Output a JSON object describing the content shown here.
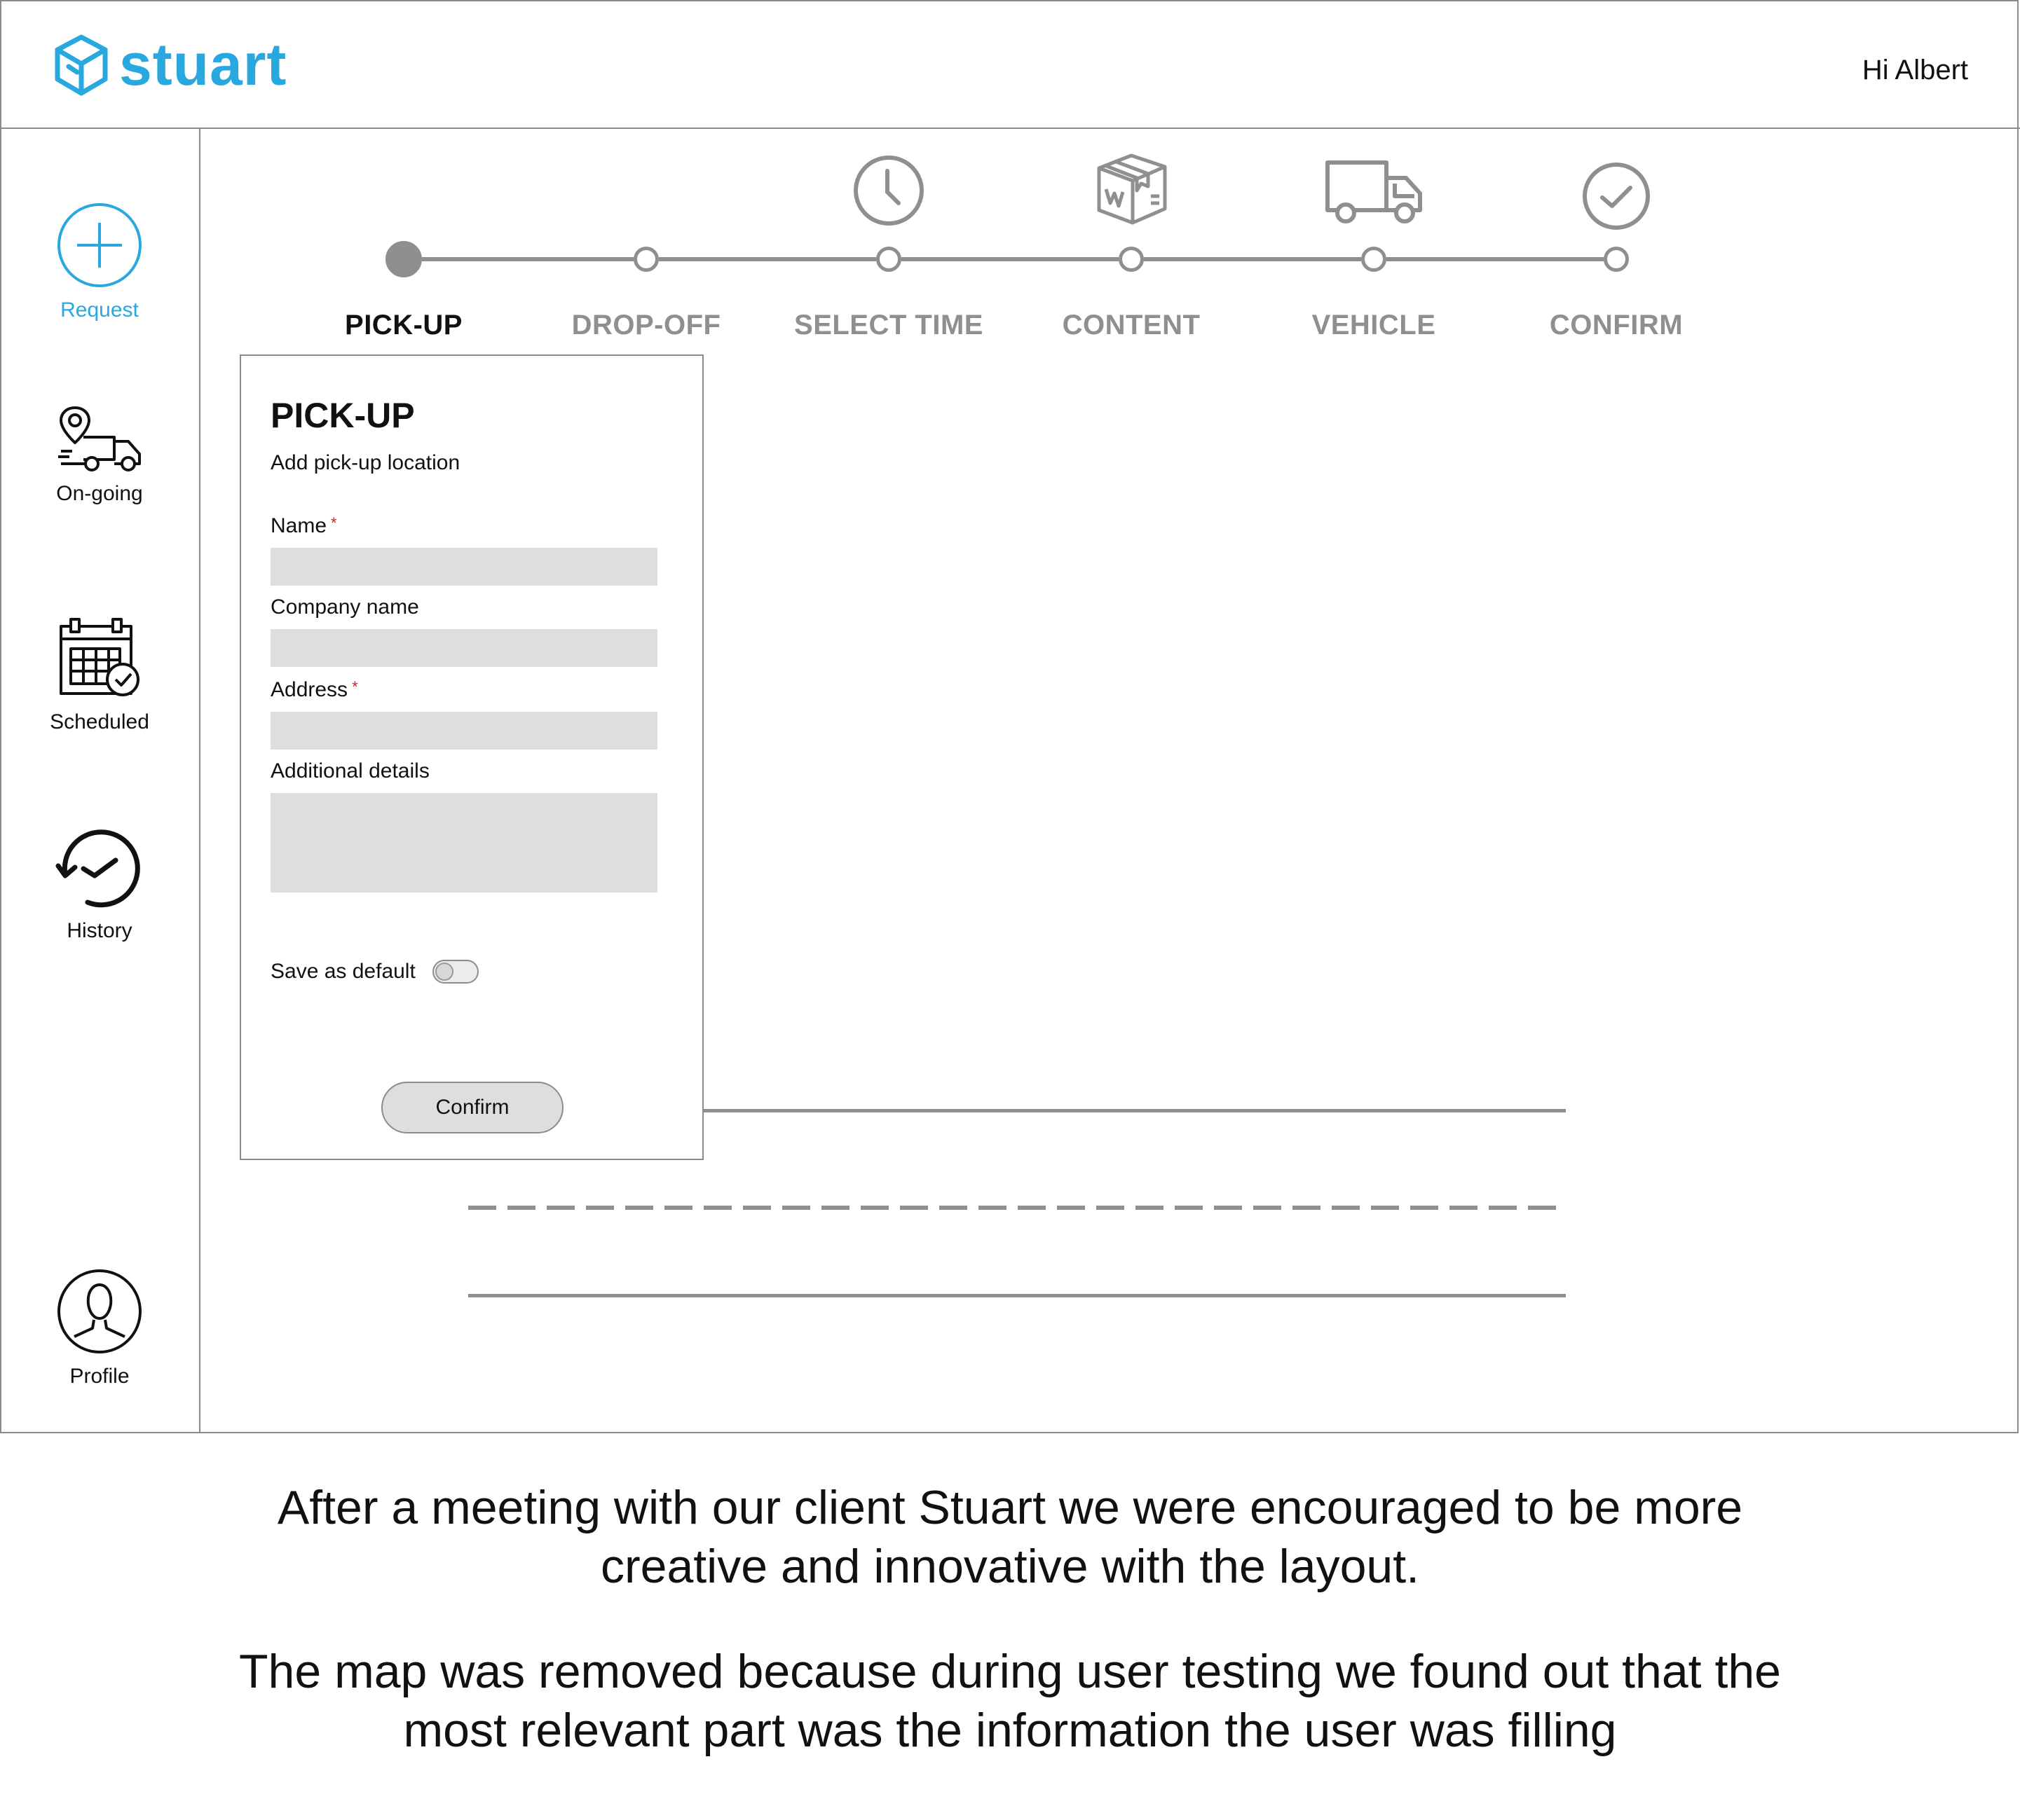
{
  "brand": {
    "name": "stuart",
    "color": "#29a8e0"
  },
  "header": {
    "greeting": "Hi Albert"
  },
  "sidebar": {
    "items": [
      {
        "label": "Request",
        "icon": "plus-circle-icon",
        "active": true
      },
      {
        "label": "On-going",
        "icon": "delivery-truck-location-icon"
      },
      {
        "label": "Scheduled",
        "icon": "calendar-check-icon"
      },
      {
        "label": "History",
        "icon": "history-clock-icon"
      },
      {
        "label": "Profile",
        "icon": "user-profile-icon"
      }
    ]
  },
  "stepper": {
    "current": 0,
    "steps": [
      {
        "label": "PICK-UP"
      },
      {
        "label": "DROP-OFF"
      },
      {
        "label": "SELECT TIME",
        "icon": "clock-icon"
      },
      {
        "label": "CONTENT",
        "icon": "package-box-icon"
      },
      {
        "label": "VEHICLE",
        "icon": "truck-icon"
      },
      {
        "label": "CONFIRM",
        "icon": "check-circle-icon"
      }
    ]
  },
  "form": {
    "title": "PICK-UP",
    "subtitle": "Add pick-up location",
    "fields": {
      "name": {
        "label": "Name",
        "required_mark": "*",
        "value": ""
      },
      "company": {
        "label": "Company name",
        "value": ""
      },
      "address": {
        "label": "Address",
        "required_mark": "*",
        "value": ""
      },
      "details": {
        "label": "Additional details",
        "value": ""
      }
    },
    "save_default": {
      "label": "Save as default",
      "on": false
    },
    "confirm_label": "Confirm"
  },
  "caption": {
    "paragraph1": "After a meeting with our client Stuart we were encouraged to be more creative and innovative with the layout.",
    "paragraph2": "The map was removed because during user testing we found out that the most relevant part was the information the user was filling"
  }
}
